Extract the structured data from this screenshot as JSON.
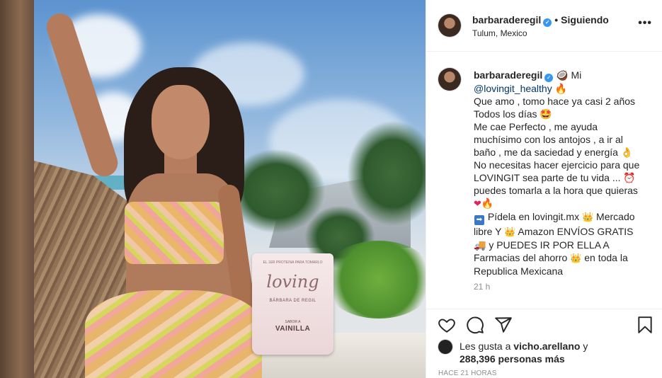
{
  "header": {
    "username": "barbaraderegil",
    "verified_glyph": "✓",
    "separator": "•",
    "follow_status": "Siguiendo",
    "location": "Tulum, Mexico",
    "more_glyph": "•••"
  },
  "caption": {
    "username": "barbaraderegil",
    "lines": [
      "Mi",
      "@lovingit_healthy",
      "Que amo , tomo hace ya casi 2 años",
      "Todos los días",
      "Me cae Perfecto , me ayuda",
      "muchísimo con los antojos , a ir al",
      "baño , me da saciedad y energía",
      "No necesitas hacer ejercicio para que",
      "LOVINGIT sea parte de tu vida ...",
      "puedes tomarla a la hora que quieras",
      "Pídela en lovingit.mx",
      "Mercado",
      "libre Y",
      "Amazon ENVÍOS GRATIS",
      "y PUEDES IR POR ELLA A",
      "Farmacias del ahorro",
      "en toda la",
      "Republica Mexicana"
    ],
    "time": "21 h"
  },
  "emojis": {
    "coconut": "🥥",
    "fire": "🔥",
    "star_struck": "🤩",
    "ok_hand": "👌",
    "alarm_clock": "⏰",
    "heart": "❤",
    "right_arrow": "➡",
    "crown": "👑",
    "truck": "🚚"
  },
  "likes": {
    "prefix": "Les gusta a",
    "user": "vicho.arellano",
    "joiner": "y",
    "count_text": "288,396 personas más"
  },
  "timestamp": "HACE 21 HORAS",
  "product": {
    "top_text": "EL 1ER PROTEINA PARA TOMARLO",
    "logo": "loving",
    "brand": "BÁRBARA DE REGIL",
    "flavor_small": "SABOR A",
    "flavor": "VAINILLA"
  },
  "icons": [
    "verified-badge-icon",
    "more-options-icon",
    "heart-icon",
    "comment-icon",
    "share-icon",
    "bookmark-icon"
  ],
  "colors": {
    "link": "#00376b",
    "verified": "#3897f0",
    "muted": "#8e8e8e",
    "text": "#262626"
  }
}
